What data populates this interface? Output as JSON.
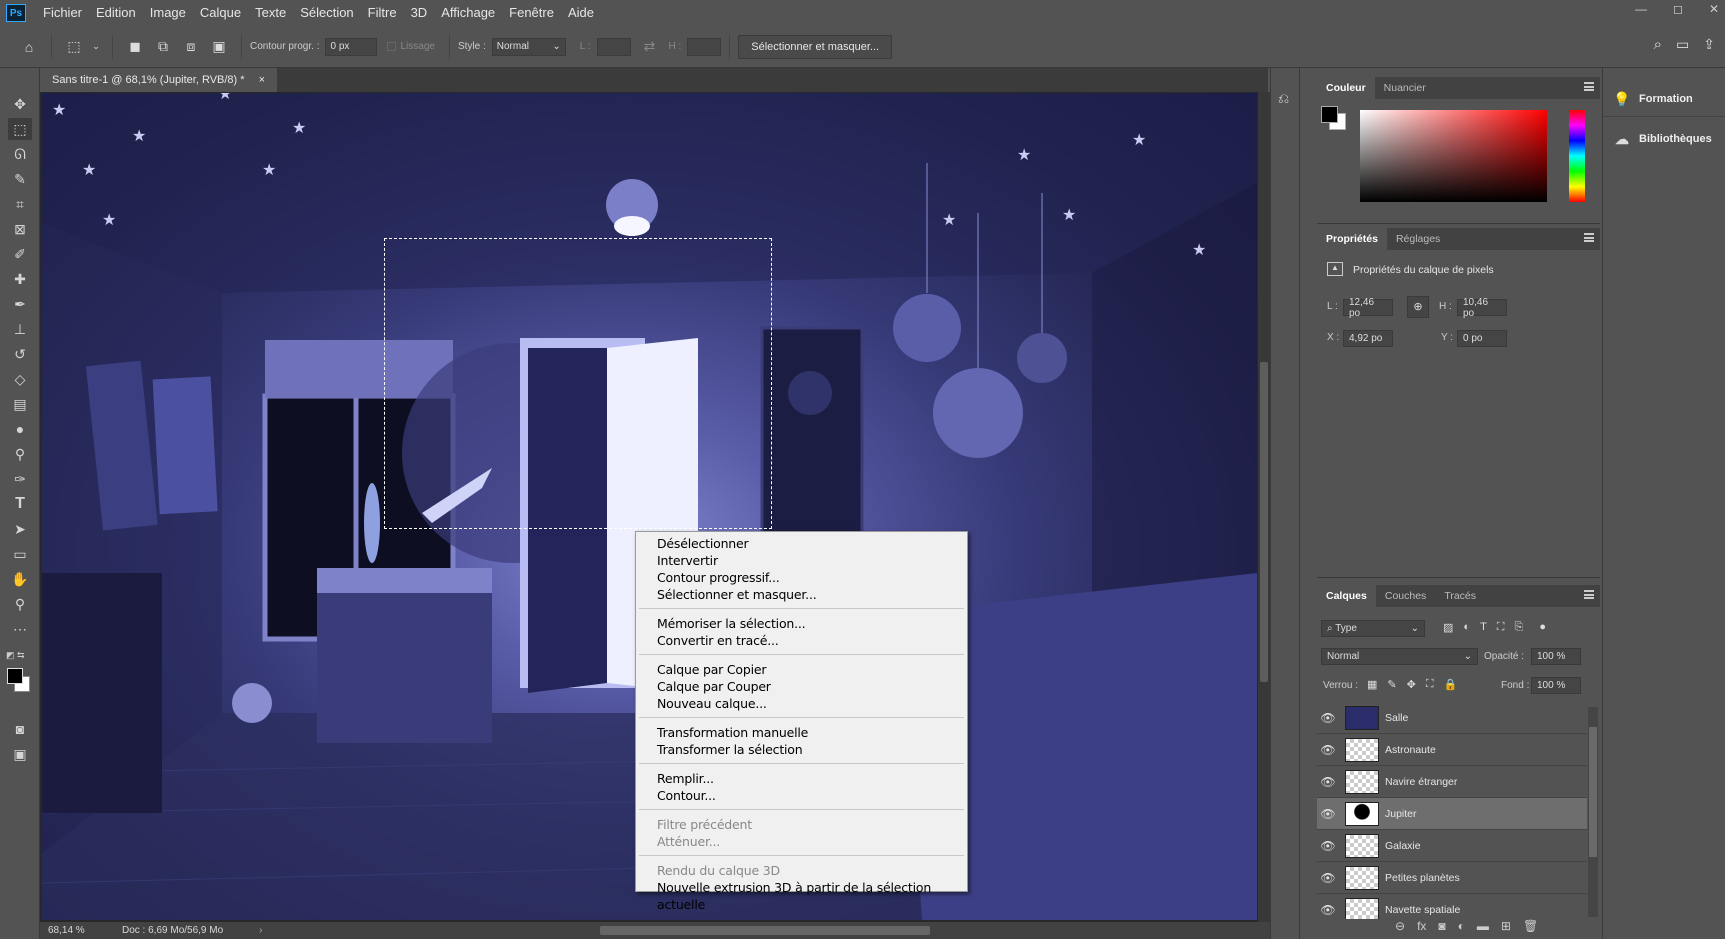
{
  "app": {
    "logo": "Ps"
  },
  "menubar": {
    "items": [
      "Fichier",
      "Edition",
      "Image",
      "Calque",
      "Texte",
      "Sélection",
      "Filtre",
      "3D",
      "Affichage",
      "Fenêtre",
      "Aide"
    ]
  },
  "window_controls": {
    "minimize": "—",
    "maximize": "◻",
    "close": "✕"
  },
  "options_bar": {
    "feather_label": "Contour progr. :",
    "feather_value": "0 px",
    "antialias_label": "Lissage",
    "style_label": "Style :",
    "style_value": "Normal",
    "width_label": "L :",
    "height_label": "H :",
    "select_mask_button": "Sélectionner et masquer..."
  },
  "document": {
    "tab_title": "Sans titre-1 @ 68,1% (Jupiter, RVB/8) *",
    "close_glyph": "×"
  },
  "status": {
    "zoom": "68,14 %",
    "doc": "Doc : 6,69 Mo/56,9 Mo"
  },
  "right_strip": {
    "formation": "Formation",
    "libraries": "Bibliothèques"
  },
  "color_panel": {
    "tabs": [
      "Couleur",
      "Nuancier"
    ],
    "foreground": "#000000",
    "background": "#ffffff"
  },
  "properties_panel": {
    "tabs": [
      "Propriétés",
      "Réglages"
    ],
    "subtitle": "Propriétés du calque de pixels",
    "w_label": "L :",
    "w_value": "12,46 po",
    "h_label": "H :",
    "h_value": "10,46 po",
    "x_label": "X :",
    "x_value": "4,92 po",
    "y_label": "Y :",
    "y_value": "0 po"
  },
  "layers_panel": {
    "tabs": [
      "Calques",
      "Couches",
      "Tracés"
    ],
    "filter_value": "Type",
    "blend_mode": "Normal",
    "opacity_label": "Opacité :",
    "opacity_value": "100 %",
    "lock_label": "Verrou :",
    "fill_label": "Fond :",
    "fill_value": "100 %",
    "layers": [
      "Salle",
      "Astronaute",
      "Navire étranger",
      "Jupiter",
      "Galaxie",
      "Petites planètes",
      "Navette spatiale"
    ],
    "selected": "Jupiter"
  },
  "context_menu": {
    "groups": [
      [
        "Désélectionner",
        "Intervertir",
        "Contour progressif...",
        "Sélectionner et masquer..."
      ],
      [
        "Mémoriser la sélection...",
        "Convertir en tracé..."
      ],
      [
        "Calque par Copier",
        "Calque par Couper",
        "Nouveau calque..."
      ],
      [
        "Transformation manuelle",
        "Transformer la sélection"
      ],
      [
        "Remplir...",
        "Contour..."
      ],
      [
        "Filtre précédent",
        "Atténuer..."
      ],
      [
        "Rendu du calque 3D",
        "Nouvelle extrusion 3D à partir de la sélection actuelle"
      ]
    ],
    "disabled": [
      "Filtre précédent",
      "Atténuer...",
      "Rendu du calque 3D"
    ]
  }
}
